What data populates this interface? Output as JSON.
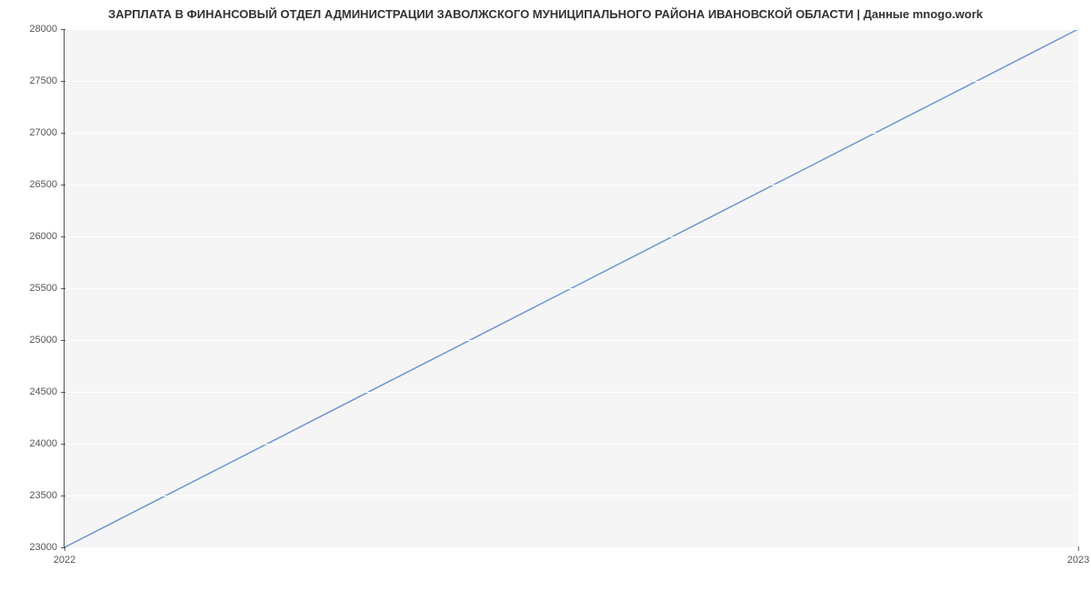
{
  "chart_data": {
    "type": "line",
    "title": "ЗАРПЛАТА В ФИНАНСОВЫЙ ОТДЕЛ АДМИНИСТРАЦИИ ЗАВОЛЖСКОГО МУНИЦИПАЛЬНОГО РАЙОНА ИВАНОВСКОЙ ОБЛАСТИ | Данные mnogo.work",
    "x": [
      2022,
      2023
    ],
    "values": [
      23000,
      28000
    ],
    "y_ticks": [
      23000,
      23500,
      24000,
      24500,
      25000,
      25500,
      26000,
      26500,
      27000,
      27500,
      28000
    ],
    "x_ticks": [
      2022,
      2023
    ],
    "x_tick_labels": [
      "2022",
      "2023"
    ],
    "ylim": [
      23000,
      28000
    ],
    "xlim": [
      2022,
      2023
    ],
    "xlabel": "",
    "ylabel": "",
    "line_color": "#6f96d1"
  }
}
